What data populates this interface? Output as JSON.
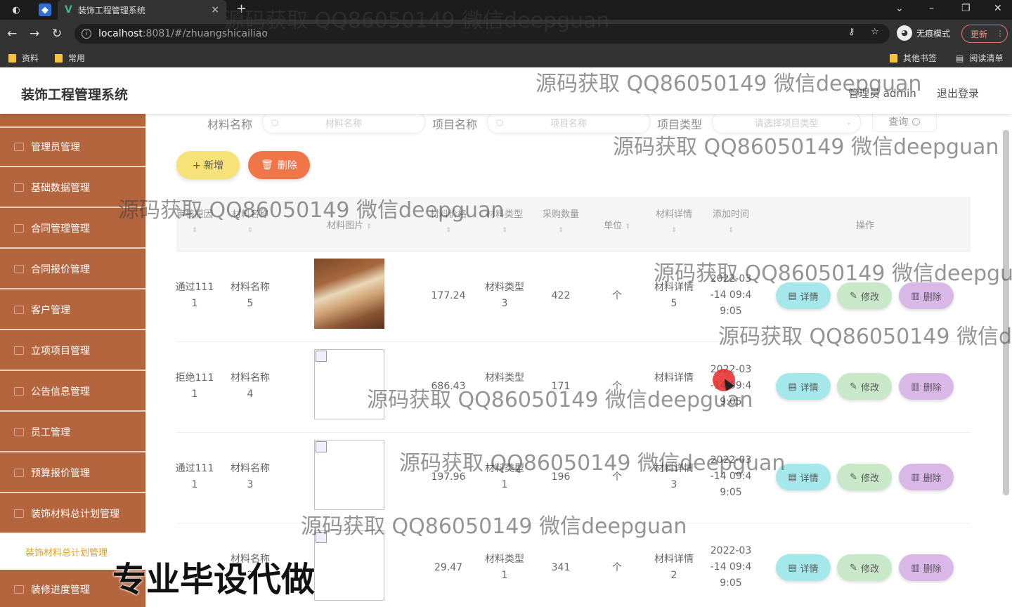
{
  "browser": {
    "tab_title": "装饰工程管理系统",
    "tab_close": "×",
    "new_tab": "+",
    "url_host": "localhost",
    "url_path": ":8081/#/zhuangshicailiao",
    "incognito_label": "无痕模式",
    "update_label": "更新",
    "bookmarks": [
      "资料",
      "常用"
    ],
    "bookmarks_right": [
      "其他书签",
      "阅读清单"
    ]
  },
  "header": {
    "title": "装饰工程管理系统",
    "user": "管理员 admin",
    "logout": "退出登录"
  },
  "sidebar": {
    "items": [
      "管理员管理",
      "基础数据管理",
      "合同管理管理",
      "合同报价管理",
      "客户管理",
      "立项项目管理",
      "公告信息管理",
      "员工管理",
      "预算报价管理",
      "装饰材料总计划管理"
    ],
    "active_sub": "装饰材料总计划管理",
    "last_item": "装修进度管理"
  },
  "search": {
    "label1": "材料名称",
    "placeholder1": "材料名称",
    "label2": "项目名称",
    "placeholder2": "项目名称",
    "label3": "项目类型",
    "placeholder3": "请选择项目类型",
    "query": "查询"
  },
  "toolbar": {
    "add": "+ 新增",
    "delete": "删除"
  },
  "table": {
    "headers": [
      "审核原因",
      "材料名称",
      "材料图片",
      "材料价格",
      "材料类型",
      "采购数量",
      "单位",
      "材料详情",
      "添加时间",
      "操作"
    ],
    "rows": [
      {
        "reason": "通过111",
        "reason2": "1",
        "name": "材料名称",
        "name2": "5",
        "price": "177.24",
        "type": "材料类型",
        "type2": "3",
        "qty": "422",
        "unit": "个",
        "detail": "材料详情",
        "detail2": "5",
        "time1": "2022-03",
        "time2": "-14 09:4",
        "time3": "9:05"
      },
      {
        "reason": "拒绝111",
        "reason2": "1",
        "name": "材料名称",
        "name2": "4",
        "price": "686.43",
        "type": "材料类型",
        "type2": "",
        "qty": "171",
        "unit": "个",
        "detail": "材料详情",
        "detail2": "",
        "time1": "2022-03",
        "time2": "-14 09:4",
        "time3": "9:05"
      },
      {
        "reason": "通过111",
        "reason2": "1",
        "name": "材料名称",
        "name2": "3",
        "price": "197.96",
        "type": "材料类型",
        "type2": "1",
        "qty": "196",
        "unit": "个",
        "detail": "材料详情",
        "detail2": "3",
        "time1": "2022-03",
        "time2": "-14 09:4",
        "time3": "9:05"
      },
      {
        "reason": "",
        "reason2": "",
        "name": "材料名称",
        "name2": "2",
        "price": "29.47",
        "type": "材料类型",
        "type2": "1",
        "qty": "341",
        "unit": "个",
        "detail": "材料详情",
        "detail2": "2",
        "time1": "2022-03",
        "time2": "-14 09:4",
        "time3": "9:05"
      }
    ],
    "actions": {
      "detail": "详情",
      "edit": "修改",
      "remove": "删除"
    }
  },
  "watermark": "源码获取 QQ86050149 微信deepguan",
  "stamp": "专业毕设代做"
}
